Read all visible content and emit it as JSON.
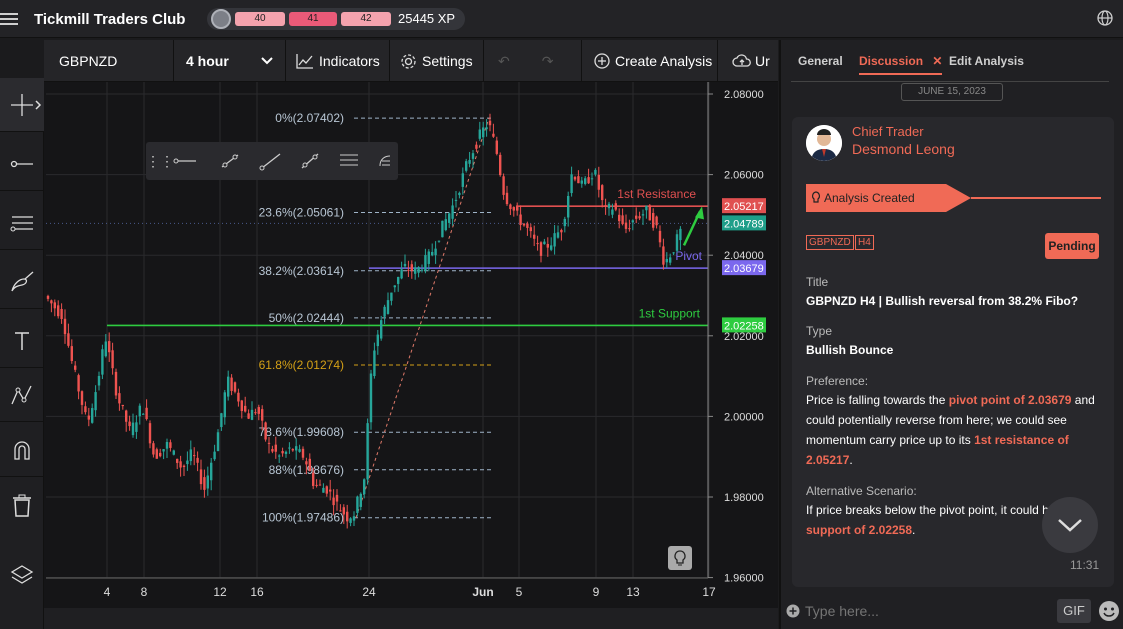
{
  "app": {
    "title": "Tickmill Traders Club",
    "xp_segments": [
      "40",
      "41",
      "42"
    ],
    "xp_value": "25445 XP"
  },
  "toolbar": {
    "symbol": "GBPNZD",
    "timeframe": "4 hour",
    "indicators": "Indicators",
    "settings": "Settings",
    "create_analysis": "Create Analysis",
    "upload_label": "Ur"
  },
  "chart": {
    "y_ticks": [
      "2.08000",
      "2.06000",
      "2.04000",
      "2.02000",
      "2.00000",
      "1.98000",
      "1.96000"
    ],
    "x_ticks": [
      "4",
      "8",
      "12",
      "16",
      "24",
      "Jun",
      "5",
      "9",
      "13",
      "17"
    ],
    "fib_labels": [
      "0%(2.07402)",
      "23.6%(2.05061)",
      "38.2%(2.03614)",
      "50%(2.02444)",
      "61.8%(2.01274)",
      "78.6%(1.99608)",
      "88%(1.98676)",
      "100%(1.97486)"
    ],
    "level_labels": {
      "resistance": "1st Resistance",
      "pivot": "Pivot",
      "support": "1st Support"
    },
    "price_tags": {
      "resistance": "2.05217",
      "current": "2.04789",
      "pivot": "2.03679",
      "support": "2.02258"
    },
    "colors": {
      "resistance": "#e05050",
      "current": "#1f9e89",
      "pivot": "#7b68ee",
      "support": "#2ecc40",
      "up": "#26a69a",
      "down": "#ef5350"
    }
  },
  "panel": {
    "tabs": [
      "General",
      "Discussion",
      "Edit Analysis"
    ],
    "date": "JUNE 15, 2023",
    "author_role": "Chief Trader",
    "author_name": "Desmond Leong",
    "banner": "Analysis Created",
    "tags": [
      "GBPNZD",
      "H4"
    ],
    "status": "Pending",
    "title_label": "Title",
    "title": "GBPNZD H4 | Bullish reversal from 38.2% Fibo?",
    "type_label": "Type",
    "type": "Bullish Bounce",
    "preference_label": "Preference:",
    "pref_1": "Price is falling towards the ",
    "pref_hl1": "pivot point of 2.03679",
    "pref_2": " and could potentially reverse from here; we could see momentum carry price up to its ",
    "pref_hl2": "1st resistance of 2.05217",
    "pref_3": ".",
    "alt_label": "Alternative Scenario:",
    "alt_1": "If price breaks below the pivot point, it could h",
    "alt_hl": "support of 2.02258",
    "alt_2": ".",
    "time": "11:31",
    "input_placeholder": "Type here...",
    "gif": "GIF"
  }
}
